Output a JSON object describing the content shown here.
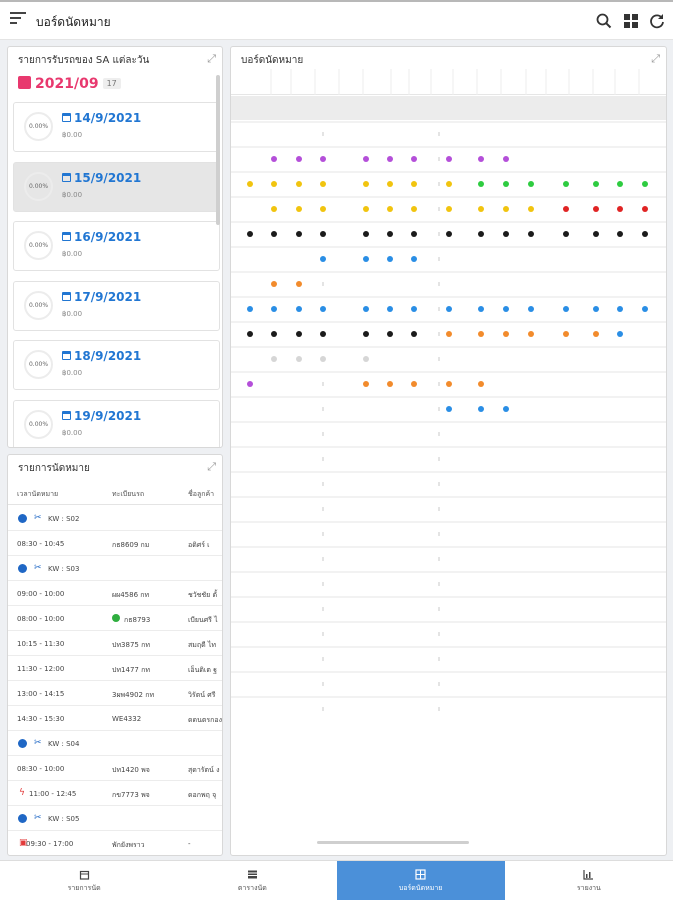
{
  "header": {
    "title": "บอร์ดนัดหมาย",
    "icons": [
      "menu-icon",
      "search-icon",
      "grid-icon",
      "refresh-icon"
    ]
  },
  "sa_panel": {
    "title": "รายการรับรถของ SA แต่ละวัน",
    "month": "2021/09",
    "count": "17",
    "days": [
      {
        "date": "14/9/2021",
        "percent": "0.00%",
        "amount": "฿0.00",
        "selected": false
      },
      {
        "date": "15/9/2021",
        "percent": "0.00%",
        "amount": "฿0.00",
        "selected": true
      },
      {
        "date": "16/9/2021",
        "percent": "0.00%",
        "amount": "฿0.00",
        "selected": false
      },
      {
        "date": "17/9/2021",
        "percent": "0.00%",
        "amount": "฿0.00",
        "selected": false
      },
      {
        "date": "18/9/2021",
        "percent": "0.00%",
        "amount": "฿0.00",
        "selected": false
      },
      {
        "date": "19/9/2021",
        "percent": "0.00%",
        "amount": "฿0.00",
        "selected": false
      }
    ]
  },
  "appt_panel": {
    "title": "รายการนัดหมาย",
    "columns": [
      "เวลานัดหมาย",
      "ทะเบียนรถ",
      "ชื่อลูกค้า"
    ],
    "groups": [
      {
        "label": "KW : S02",
        "rows": [
          {
            "time": "08:30 - 10:45",
            "plate": "กธ8609 กม",
            "name": "อดิศร์ เ",
            "icon": ""
          }
        ]
      },
      {
        "label": "KW : S03",
        "rows": [
          {
            "time": "09:00 - 10:00",
            "plate": "ผผ4586 กท",
            "name": "ชวัชชัย ตั้",
            "icon": ""
          },
          {
            "time": "08:00 - 10:00",
            "plate": "กธ8793",
            "name": "เบียนศรี ไ",
            "icon": "check"
          },
          {
            "time": "10:15 - 11:30",
            "plate": "ปท3875 กท",
            "name": "สมฤดี ไท",
            "icon": ""
          },
          {
            "time": "11:30 - 12:00",
            "plate": "ปท1477 กท",
            "name": "เอ็นติเต ฐ",
            "icon": ""
          },
          {
            "time": "13:00 - 14:15",
            "plate": "3ผพ4902 กท",
            "name": "วิรัตน์ ศรี",
            "icon": ""
          },
          {
            "time": "14:30 - 15:30",
            "plate": "WE4332",
            "name": "ดดนตรกอง",
            "icon": ""
          }
        ]
      },
      {
        "label": "KW : S04",
        "rows": [
          {
            "time": "08:30 - 10:00",
            "plate": "ปท1420 พจ",
            "name": "สุดารัตน์ ง",
            "icon": ""
          },
          {
            "time": "11:00 - 12:45",
            "plate": "กข7773 พจ",
            "name": "ดอกพฤ จุ",
            "icon": "bolt"
          }
        ]
      },
      {
        "label": "KW : S05",
        "rows": [
          {
            "time": "09:30 - 17:00",
            "plate": "พักยังพราว",
            "name": "-",
            "icon": "dash"
          }
        ]
      }
    ]
  },
  "board": {
    "title": "บอร์ดนัดหมาย",
    "colors": {
      "purple": "#b44fd9",
      "yellow": "#f1c40f",
      "green": "#2ecc40",
      "red": "#e02424",
      "black": "#1b1b1b",
      "blue": "#2a8ee5",
      "orange": "#f28b2c",
      "lightgray": "#d6d6d6"
    }
  },
  "bottom_nav": {
    "items": [
      {
        "label": "รายการนัด",
        "icon": "calendar-icon",
        "active": false
      },
      {
        "label": "ตารางนัด",
        "icon": "table-icon",
        "active": false
      },
      {
        "label": "บอร์ดนัดหมาย",
        "icon": "board-icon",
        "active": true
      },
      {
        "label": "รายงาน",
        "icon": "chart-icon",
        "active": false
      }
    ]
  }
}
